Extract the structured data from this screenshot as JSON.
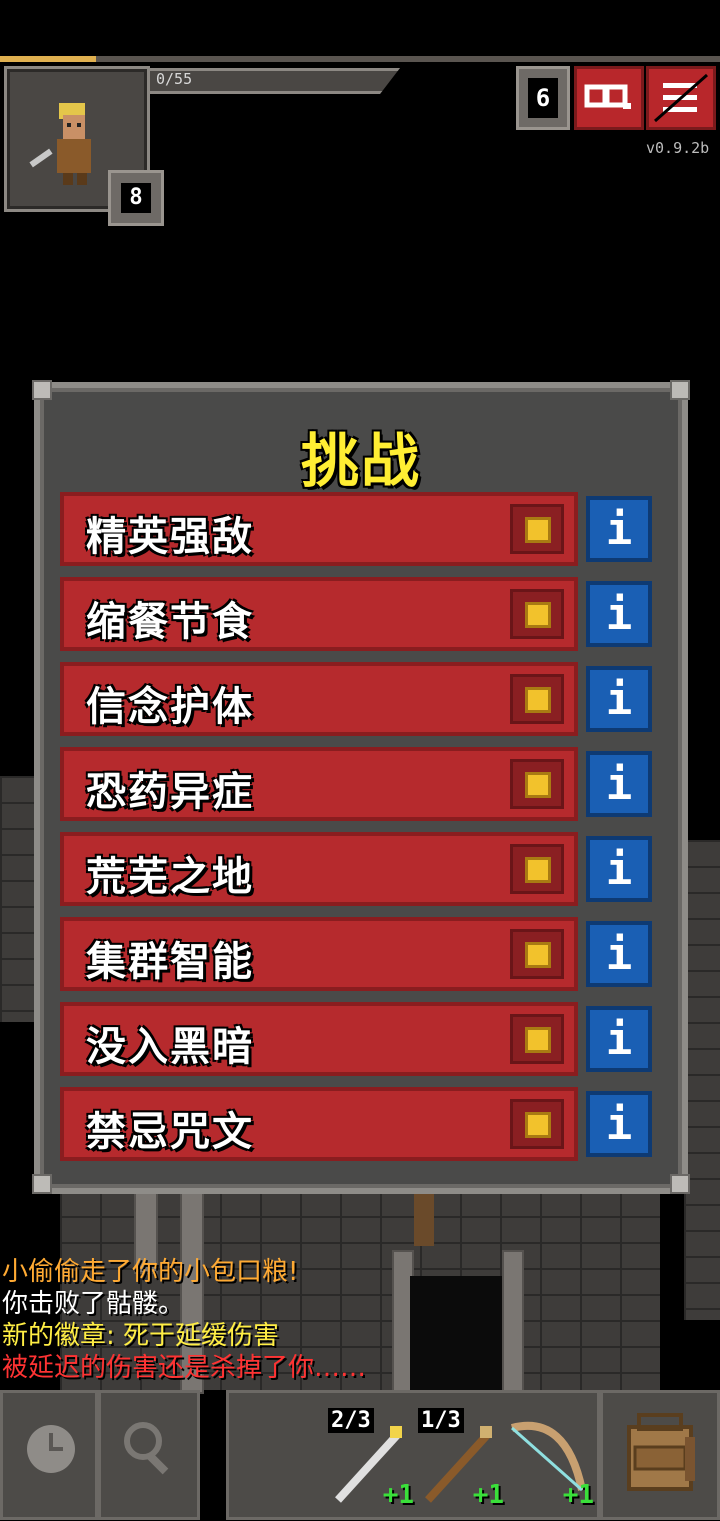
{
  "hud": {
    "hp_text": "0/55",
    "hero_level": "8",
    "depth": "6",
    "journal_icon": "journal-icon",
    "menu_icon": "menu-icon",
    "version": "v0.9.2b"
  },
  "dialog": {
    "title": "挑战",
    "challenges": [
      {
        "label": "精英强敌",
        "enabled": true
      },
      {
        "label": "缩餐节食",
        "enabled": true
      },
      {
        "label": "信念护体",
        "enabled": true
      },
      {
        "label": "恐药异症",
        "enabled": true
      },
      {
        "label": "荒芜之地",
        "enabled": true
      },
      {
        "label": "集群智能",
        "enabled": true
      },
      {
        "label": "没入黑暗",
        "enabled": true
      },
      {
        "label": "禁忌咒文",
        "enabled": true
      }
    ],
    "info_glyph": "i"
  },
  "log": [
    {
      "text": "小偷偷走了你的小包口粮!",
      "color": "#ffaa33"
    },
    {
      "text": "你击败了骷髅。",
      "color": "#ffffff"
    },
    {
      "text": "新的徽章: 死于延缓伤害",
      "color": "#ffee44"
    },
    {
      "text": "被延迟的伤害还是杀掉了你……",
      "color": "#ff3333"
    }
  ],
  "toolbar": {
    "wait_icon": "clock-icon",
    "search_icon": "magnifier-icon",
    "quickslots": [
      {
        "icon": "wand-icon",
        "count": "2/3",
        "upgrade": "+1"
      },
      {
        "icon": "wand-icon",
        "count": "1/3",
        "upgrade": "+1"
      },
      {
        "icon": "bow-icon",
        "count": "",
        "upgrade": "+1"
      }
    ],
    "backpack_icon": "backpack-icon"
  }
}
